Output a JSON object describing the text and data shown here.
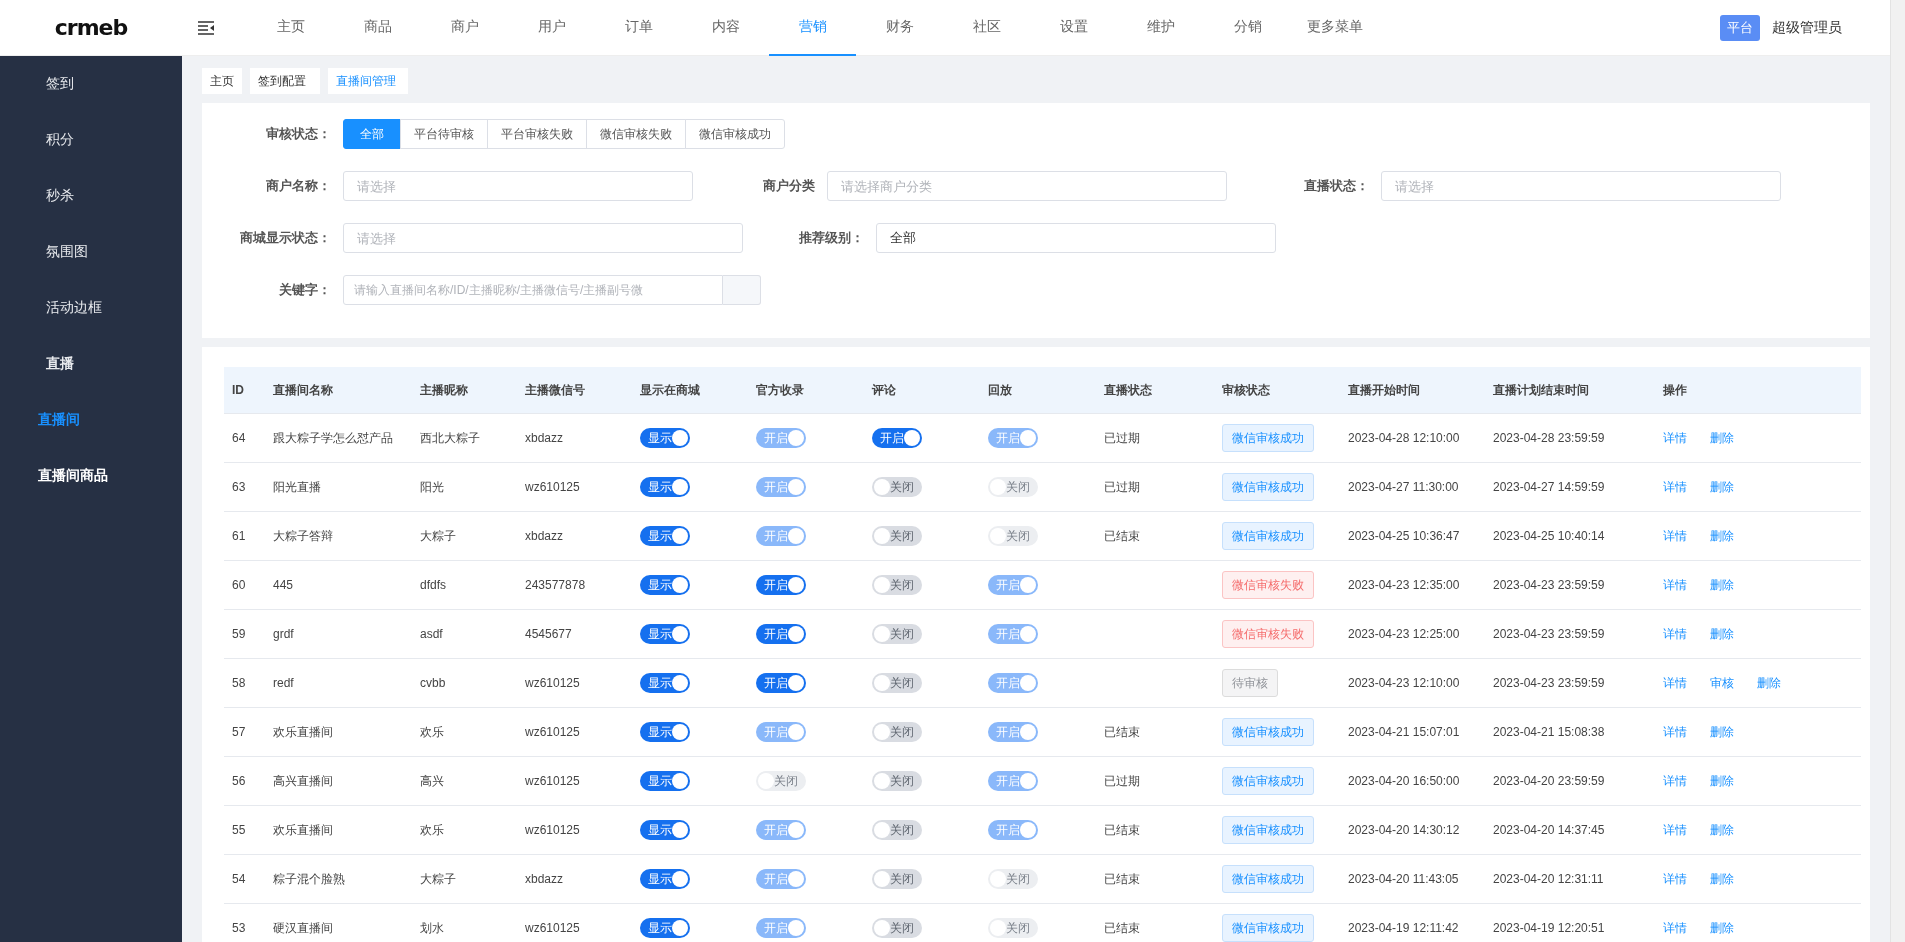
{
  "logo": "crmeb",
  "top_nav": [
    {
      "label": "主页",
      "selected": false
    },
    {
      "label": "商品",
      "selected": false
    },
    {
      "label": "商户",
      "selected": false
    },
    {
      "label": "用户",
      "selected": false
    },
    {
      "label": "订单",
      "selected": false
    },
    {
      "label": "内容",
      "selected": false
    },
    {
      "label": "营销",
      "selected": true
    },
    {
      "label": "财务",
      "selected": false
    },
    {
      "label": "社区",
      "selected": false
    },
    {
      "label": "设置",
      "selected": false
    },
    {
      "label": "维护",
      "selected": false
    },
    {
      "label": "分销",
      "selected": false
    },
    {
      "label": "更多菜单",
      "selected": false
    }
  ],
  "user": {
    "role_badge": "平台",
    "name": "超级管理员"
  },
  "sidebar": {
    "items": [
      {
        "label": "签到",
        "selected": false
      },
      {
        "label": "积分",
        "selected": false
      },
      {
        "label": "秒杀",
        "selected": false
      },
      {
        "label": "氛围图",
        "selected": false
      },
      {
        "label": "活动边框",
        "selected": false
      },
      {
        "label": "直播",
        "selected": false,
        "children": [
          {
            "label": "直播间",
            "selected": true
          },
          {
            "label": "直播间商品",
            "selected": false
          }
        ]
      }
    ]
  },
  "breadcrumbs": [
    {
      "label": "主页",
      "selected": false
    },
    {
      "label": "签到配置",
      "selected": false
    },
    {
      "label": "直播间管理",
      "selected": true
    }
  ],
  "filters": {
    "audit_status": {
      "label": "审核状态：",
      "options": [
        {
          "label": "全部",
          "selected": true
        },
        {
          "label": "平台待审核",
          "selected": false
        },
        {
          "label": "平台审核失败",
          "selected": false
        },
        {
          "label": "微信审核失败",
          "selected": false
        },
        {
          "label": "微信审核成功",
          "selected": false
        }
      ]
    },
    "rows": [
      [
        {
          "kind": "select",
          "label": "商户名称：",
          "placeholder": "请选择"
        },
        {
          "kind": "select",
          "label": "商户分类",
          "placeholder": "请选择商户分类"
        },
        {
          "kind": "select",
          "label": "直播状态：",
          "placeholder": "请选择"
        }
      ],
      [
        {
          "kind": "select",
          "label": "商城显示状态：",
          "placeholder": "请选择"
        },
        {
          "kind": "select",
          "label": "推荐级别：",
          "value": "全部"
        }
      ],
      [
        {
          "kind": "search",
          "label": "关键字：",
          "placeholder": "请输入直播间名称/ID/主播昵称/主播微信号/主播副号微"
        }
      ]
    ]
  },
  "table": {
    "columns": [
      "ID",
      "直播间名称",
      "主播昵称",
      "主播微信号",
      "显示在商城",
      "官方收录",
      "评论",
      "回放",
      "直播状态",
      "审核状态",
      "直播开始时间",
      "直播计划结束时间",
      "操作"
    ],
    "rows": [
      {
        "id": "64",
        "name": "跟大粽子学怎么怼产品",
        "nickname": "西北大粽子",
        "wechat": "xbdazz",
        "show": {
          "label": "显示",
          "on": true,
          "disabled": false
        },
        "official": {
          "label": "开启",
          "on": true,
          "disabled": true
        },
        "comment": {
          "label": "开启",
          "on": true,
          "disabled": false
        },
        "playback": {
          "label": "开启",
          "on": true,
          "disabled": true
        },
        "live_status": "已过期",
        "audit": {
          "label": "微信审核成功",
          "kind": "success"
        },
        "start": "2023-04-28 12:10:00",
        "end": "2023-04-28 23:59:59",
        "actions": [
          "详情",
          "删除"
        ]
      },
      {
        "id": "63",
        "name": "阳光直播",
        "nickname": "阳光",
        "wechat": "wz610125",
        "show": {
          "label": "显示",
          "on": true,
          "disabled": false
        },
        "official": {
          "label": "开启",
          "on": true,
          "disabled": true
        },
        "comment": {
          "label": "关闭",
          "on": false,
          "disabled": false
        },
        "playback": {
          "label": "关闭",
          "on": false,
          "disabled": true
        },
        "live_status": "已过期",
        "audit": {
          "label": "微信审核成功",
          "kind": "success"
        },
        "start": "2023-04-27 11:30:00",
        "end": "2023-04-27 14:59:59",
        "actions": [
          "详情",
          "删除"
        ]
      },
      {
        "id": "61",
        "name": "大粽子答辩",
        "nickname": "大粽子",
        "wechat": "xbdazz",
        "show": {
          "label": "显示",
          "on": true,
          "disabled": false
        },
        "official": {
          "label": "开启",
          "on": true,
          "disabled": true
        },
        "comment": {
          "label": "关闭",
          "on": false,
          "disabled": false
        },
        "playback": {
          "label": "关闭",
          "on": false,
          "disabled": true
        },
        "live_status": "已结束",
        "audit": {
          "label": "微信审核成功",
          "kind": "success"
        },
        "start": "2023-04-25 10:36:47",
        "end": "2023-04-25 10:40:14",
        "actions": [
          "详情",
          "删除"
        ]
      },
      {
        "id": "60",
        "name": "445",
        "nickname": "dfdfs",
        "wechat": "243577878",
        "show": {
          "label": "显示",
          "on": true,
          "disabled": false
        },
        "official": {
          "label": "开启",
          "on": true,
          "disabled": false
        },
        "comment": {
          "label": "关闭",
          "on": false,
          "disabled": false
        },
        "playback": {
          "label": "开启",
          "on": true,
          "disabled": true
        },
        "audit": {
          "label": "微信审核失败",
          "kind": "fail"
        },
        "start": "2023-04-23 12:35:00",
        "end": "2023-04-23 23:59:59",
        "actions": [
          "详情",
          "删除"
        ]
      },
      {
        "id": "59",
        "name": "grdf",
        "nickname": "asdf",
        "wechat": "4545677",
        "show": {
          "label": "显示",
          "on": true,
          "disabled": false
        },
        "official": {
          "label": "开启",
          "on": true,
          "disabled": false
        },
        "comment": {
          "label": "关闭",
          "on": false,
          "disabled": false
        },
        "playback": {
          "label": "开启",
          "on": true,
          "disabled": true
        },
        "audit": {
          "label": "微信审核失败",
          "kind": "fail"
        },
        "start": "2023-04-23 12:25:00",
        "end": "2023-04-23 23:59:59",
        "actions": [
          "详情",
          "删除"
        ]
      },
      {
        "id": "58",
        "name": "redf",
        "nickname": "cvbb",
        "wechat": "wz610125",
        "show": {
          "label": "显示",
          "on": true,
          "disabled": false
        },
        "official": {
          "label": "开启",
          "on": true,
          "disabled": false
        },
        "comment": {
          "label": "关闭",
          "on": false,
          "disabled": false
        },
        "playback": {
          "label": "开启",
          "on": true,
          "disabled": true
        },
        "audit": {
          "label": "待审核",
          "kind": "pending"
        },
        "start": "2023-04-23 12:10:00",
        "end": "2023-04-23 23:59:59",
        "actions": [
          "详情",
          "审核",
          "删除"
        ]
      },
      {
        "id": "57",
        "name": "欢乐直播间",
        "nickname": "欢乐",
        "wechat": "wz610125",
        "show": {
          "label": "显示",
          "on": true,
          "disabled": false
        },
        "official": {
          "label": "开启",
          "on": true,
          "disabled": true
        },
        "comment": {
          "label": "关闭",
          "on": false,
          "disabled": false
        },
        "playback": {
          "label": "开启",
          "on": true,
          "disabled": true
        },
        "live_status": "已结束",
        "audit": {
          "label": "微信审核成功",
          "kind": "success"
        },
        "start": "2023-04-21 15:07:01",
        "end": "2023-04-21 15:08:38",
        "actions": [
          "详情",
          "删除"
        ]
      },
      {
        "id": "56",
        "name": "高兴直播间",
        "nickname": "高兴",
        "wechat": "wz610125",
        "show": {
          "label": "显示",
          "on": true,
          "disabled": false
        },
        "official": {
          "label": "关闭",
          "on": false,
          "disabled": true
        },
        "comment": {
          "label": "关闭",
          "on": false,
          "disabled": false
        },
        "playback": {
          "label": "开启",
          "on": true,
          "disabled": true
        },
        "live_status": "已过期",
        "audit": {
          "label": "微信审核成功",
          "kind": "success"
        },
        "start": "2023-04-20 16:50:00",
        "end": "2023-04-20 23:59:59",
        "actions": [
          "详情",
          "删除"
        ]
      },
      {
        "id": "55",
        "name": "欢乐直播间",
        "nickname": "欢乐",
        "wechat": "wz610125",
        "show": {
          "label": "显示",
          "on": true,
          "disabled": false
        },
        "official": {
          "label": "开启",
          "on": true,
          "disabled": true
        },
        "comment": {
          "label": "关闭",
          "on": false,
          "disabled": false
        },
        "playback": {
          "label": "开启",
          "on": true,
          "disabled": true
        },
        "live_status": "已结束",
        "audit": {
          "label": "微信审核成功",
          "kind": "success"
        },
        "start": "2023-04-20 14:30:12",
        "end": "2023-04-20 14:37:45",
        "actions": [
          "详情",
          "删除"
        ]
      },
      {
        "id": "54",
        "name": "粽子混个脸熟",
        "nickname": "大粽子",
        "wechat": "xbdazz",
        "show": {
          "label": "显示",
          "on": true,
          "disabled": false
        },
        "official": {
          "label": "开启",
          "on": true,
          "disabled": true
        },
        "comment": {
          "label": "关闭",
          "on": false,
          "disabled": false
        },
        "playback": {
          "label": "关闭",
          "on": false,
          "disabled": true
        },
        "live_status": "已结束",
        "audit": {
          "label": "微信审核成功",
          "kind": "success"
        },
        "start": "2023-04-20 11:43:05",
        "end": "2023-04-20 12:31:11",
        "actions": [
          "详情",
          "删除"
        ]
      },
      {
        "id": "53",
        "name": "硬汉直播间",
        "nickname": "划水",
        "wechat": "wz610125",
        "show": {
          "label": "显示",
          "on": true,
          "disabled": false
        },
        "official": {
          "label": "开启",
          "on": true,
          "disabled": true
        },
        "comment": {
          "label": "关闭",
          "on": false,
          "disabled": false
        },
        "playback": {
          "label": "关闭",
          "on": false,
          "disabled": true
        },
        "live_status": "已结束",
        "audit": {
          "label": "微信审核成功",
          "kind": "success"
        },
        "start": "2023-04-19 12:11:42",
        "end": "2023-04-19 12:20:51",
        "actions": [
          "详情",
          "删除"
        ]
      }
    ]
  }
}
